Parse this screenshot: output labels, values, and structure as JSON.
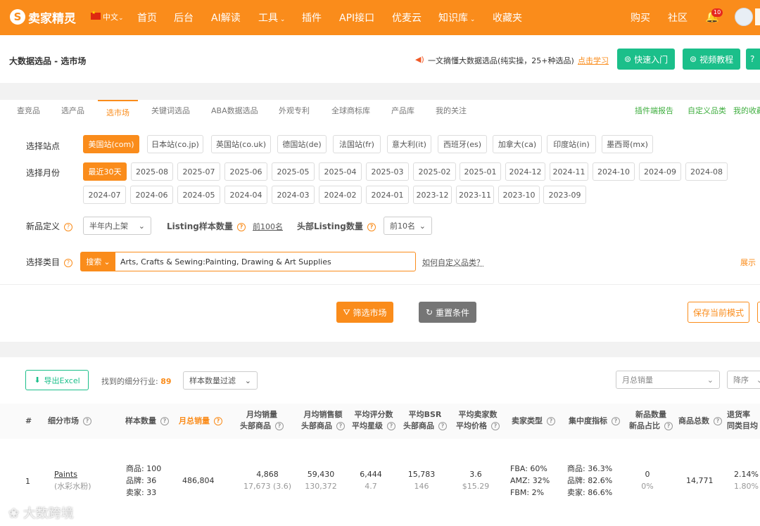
{
  "nav": {
    "logo_text": "卖家精灵",
    "lang": "中文",
    "items": [
      "首页",
      "后台",
      "AI解读",
      "工具",
      "插件",
      "API接口",
      "优麦云",
      "知识库",
      "收藏夹"
    ],
    "right": [
      "购买",
      "社区"
    ],
    "bell_badge": "10"
  },
  "header": {
    "title": "大数据选品 - 选市场",
    "announce": "一文摘懂大数据选品(纯实操，25+种选品)",
    "learn": "点击学习",
    "quick": "快速入门",
    "video": "视频教程"
  },
  "tabs": {
    "items": [
      "查竞品",
      "选产品",
      "选市场",
      "关键词选品",
      "ABA数据选品",
      "外观专利",
      "全球商标库",
      "产品库",
      "我的关注"
    ],
    "active": 2,
    "right": [
      "插件端报告",
      "自定义品类",
      "我的收藏"
    ]
  },
  "filters": {
    "station_label": "选择站点",
    "stations": [
      "美国站(com)",
      "日本站(co.jp)",
      "英国站(co.uk)",
      "德国站(de)",
      "法国站(fr)",
      "意大利(it)",
      "西班牙(es)",
      "加拿大(ca)",
      "印度站(in)",
      "墨西哥(mx)"
    ],
    "month_label": "选择月份",
    "months_row1": [
      "最近30天",
      "2025-08",
      "2025-07",
      "2025-06",
      "2025-05",
      "2025-04",
      "2025-03",
      "2025-02",
      "2025-01",
      "2024-12",
      "2024-11",
      "2024-10",
      "2024-09",
      "2024-08"
    ],
    "months_row2": [
      "2024-07",
      "2024-06",
      "2024-05",
      "2024-04",
      "2024-03",
      "2024-02",
      "2024-01",
      "2023-12",
      "2023-11",
      "2023-10",
      "2023-09"
    ],
    "newdef_label": "新品定义",
    "newdef_value": "半年内上架",
    "listing_label": "Listing样本数量",
    "listing_value": "前100名",
    "head_label": "头部Listing数量",
    "head_value": "前10名",
    "cat_label": "选择类目",
    "cat_prefix": "搜索",
    "cat_value": "Arts, Crafts & Sewing:Painting, Drawing & Art Supplies",
    "howto": "如何自定义品类？",
    "expand": "展示"
  },
  "actions": {
    "filter": "筛选市场",
    "reset": "重置条件",
    "save": "保存当前模式"
  },
  "results": {
    "export": "导出Excel",
    "found_label": "找到的细分行业:",
    "found_count": "89",
    "sample_filter": "样本数量过滤",
    "sort_field": "月总销量",
    "sort_order": "降序"
  },
  "table": {
    "headers": [
      "#",
      "细分市场",
      "样本数量",
      "月总销量",
      "月均销量",
      "头部商品",
      "月均销售额",
      "头部商品",
      "平均评分数",
      "平均星级",
      "平均BSR",
      "头部商品",
      "平均卖家数",
      "平均价格",
      "卖家类型",
      "集中度指标",
      "新品数量",
      "新品占比",
      "商品总数",
      "退货率",
      "同类目均"
    ],
    "rows": [
      {
        "idx": "1",
        "name": "Paints",
        "sub": "(水彩水粉)",
        "sample": [
          "商品: 100",
          "品牌: 36",
          "卖家: 33"
        ],
        "monthly": "486,804",
        "avg_sales": "4,868",
        "avg_sales_head": "17,673 (3.6)",
        "revenue": "59,430",
        "revenue_head": "130,372",
        "ratings": "6,444",
        "stars": "4.7",
        "bsr": "15,783",
        "bsr_head": "146",
        "sellers": "3.6",
        "price": "$15.29",
        "seller_type": [
          "FBA: 60%",
          "AMZ: 32%",
          "FBM: 2%"
        ],
        "conc": [
          "商品: 36.3%",
          "品牌: 82.6%",
          "卖家: 86.6%"
        ],
        "new_count": "0",
        "new_pct": "0%",
        "total": "14,771",
        "returns": "2.14%",
        "returns_avg": "1.80%"
      }
    ]
  },
  "watermark": "大数跨境",
  "colors": {
    "brand": "#fa8c1b",
    "green": "#1bbf8a",
    "gray_btn": "#757575"
  }
}
